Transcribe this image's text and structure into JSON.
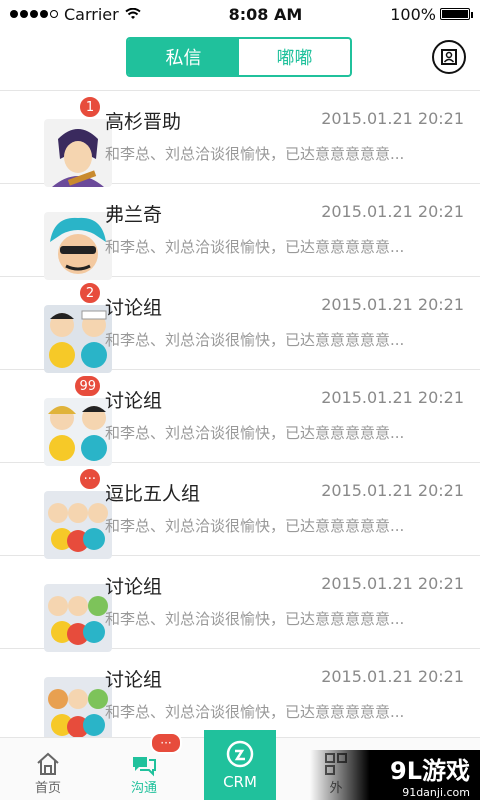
{
  "status_bar": {
    "carrier": "Carrier",
    "time": "8:08 AM",
    "battery": "100%"
  },
  "header": {
    "tabs": [
      {
        "label": "私信",
        "active": true
      },
      {
        "label": "嘟嘟",
        "active": false
      }
    ],
    "contacts_icon": "contacts-book-icon",
    "accent_color": "#20c19c"
  },
  "messages": [
    {
      "name": "高杉晋助",
      "time": "2015.01.21 20:21",
      "preview": "和李总、刘总洽谈很愉快，已达意意意意意...",
      "badge": "1"
    },
    {
      "name": "弗兰奇",
      "time": "2015.01.21 20:21",
      "preview": "和李总、刘总洽谈很愉快，已达意意意意意...",
      "badge": ""
    },
    {
      "name": "讨论组",
      "time": "2015.01.21 20:21",
      "preview": "和李总、刘总洽谈很愉快，已达意意意意意...",
      "badge": "2"
    },
    {
      "name": "讨论组",
      "time": "2015.01.21 20:21",
      "preview": "和李总、刘总洽谈很愉快，已达意意意意意...",
      "badge": "99"
    },
    {
      "name": "逗比五人组",
      "time": "2015.01.21 20:21",
      "preview": "和李总、刘总洽谈很愉快，已达意意意意意...",
      "badge": "···"
    },
    {
      "name": "讨论组",
      "time": "2015.01.21 20:21",
      "preview": "和李总、刘总洽谈很愉快，已达意意意意意...",
      "badge": ""
    },
    {
      "name": "讨论组",
      "time": "2015.01.21 20:21",
      "preview": "和李总、刘总洽谈很愉快，已达意意意意意...",
      "badge": ""
    }
  ],
  "tabbar": {
    "home": "首页",
    "chat": "沟通",
    "chat_badge": "···",
    "crm": "CRM",
    "other": "外"
  },
  "watermark": {
    "main": "9L游戏",
    "sub": "91danji.com"
  }
}
